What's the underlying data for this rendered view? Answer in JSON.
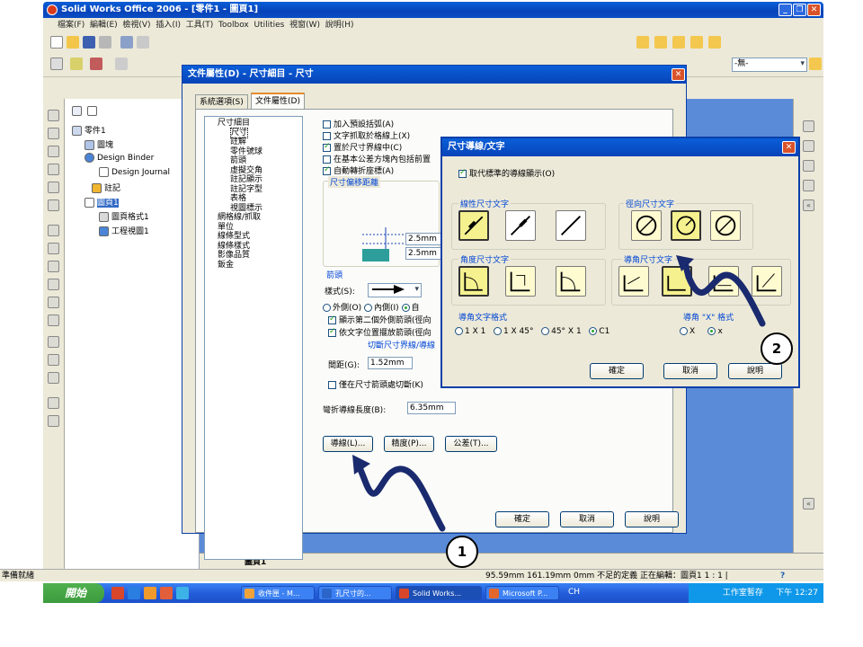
{
  "app": {
    "title": "Solid Works Office 2006 - [零件1 - 圖頁1]",
    "menu": [
      "檔案(F)",
      "編輯(E)",
      "檢視(V)",
      "插入(I)",
      "工具(T)",
      "Toolbox",
      "Utilities",
      "視窗(W)",
      "說明(H)"
    ],
    "style_dropdown": "-無-",
    "status_left": "準備就緒",
    "status_right": "95.59mm   161.19mm   0mm  不足的定義    正在編輯：圖頁1  1 : 1 |",
    "help_glyph": "?",
    "sheet_tab": "圖頁1"
  },
  "tree": {
    "items": [
      {
        "label": "零件1"
      },
      {
        "label": "圖塊"
      },
      {
        "label": "Design Binder"
      },
      {
        "label": "Design Journal"
      },
      {
        "label": "註記"
      },
      {
        "label": "圖頁1"
      },
      {
        "label": "圖頁格式1"
      },
      {
        "label": "工程視圖1"
      }
    ]
  },
  "doc_dialog": {
    "title": "文件屬性(D) - 尺寸細目 - 尺寸",
    "tabs": [
      "系統選項(S)",
      "文件屬性(D)"
    ],
    "tree": [
      "尺寸細目",
      "尺寸",
      "註解",
      "零件號球",
      "箭頭",
      "虛擬交角",
      "註記顯示",
      "註記字型",
      "表格",
      "視圖標示",
      "網格線/抓取",
      "單位",
      "線條型式",
      "線條樣式",
      "影像品質",
      "鈑金"
    ],
    "checks": [
      {
        "label": "加入預設括弧(A)",
        "on": false
      },
      {
        "label": "文字抓取於格線上(X)",
        "on": false
      },
      {
        "label": "置於尺寸界線中(C)",
        "on": true
      },
      {
        "label": "在基本公差方塊內包括前置",
        "on": false
      },
      {
        "label": "自動轉折座標(A)",
        "on": true
      }
    ],
    "offset_group": "尺寸偏移距離",
    "offset1": "2.5mm",
    "offset2": "2.5mm",
    "arrow_group": "箭頭",
    "style_label": "樣式(S):",
    "radios": [
      "外側(O)",
      "內側(I)",
      "自"
    ],
    "check_second": "顯示第二個外側箭頭(徑向",
    "check_textpos": "依文字位置擺放箭頭(徑向",
    "break_group": "切斷尺寸界線/導線",
    "gap_label": "間距(G):",
    "gap_value": "1.52mm",
    "break_only": "僅在尺寸箭頭處切斷(K)",
    "bent_label": "彎折導線長度(B):",
    "bent_value": "6.35mm",
    "btn_leader": "導線(L)...",
    "btn_precision": "精度(P)...",
    "btn_tolerance": "公差(T)...",
    "ok": "確定",
    "cancel": "取消",
    "help": "說明"
  },
  "leader_dialog": {
    "title": "尺寸導線/文字",
    "override": "取代標準的導線顯示(O)",
    "linear": "線性尺寸文字",
    "radial": "徑向尺寸文字",
    "angular": "角度尺寸文字",
    "chamfer": "導角尺寸文字",
    "chamfer_text": "導角文字格式",
    "chamfer_formats": [
      "1 X 1",
      "1 X 45°",
      "45° X 1",
      "C1"
    ],
    "chamfer_x": "導角 \"X\" 格式",
    "x_options": [
      "X",
      "x"
    ],
    "ok": "確定",
    "cancel": "取消",
    "help": "說明"
  },
  "callouts": {
    "one": "1",
    "two": "2"
  },
  "taskbar": {
    "start": "開始",
    "tasks": [
      "收件匣 - M...",
      "孔尺寸的...",
      "Solid Works...",
      "Microsoft P..."
    ],
    "lang": "CH",
    "tray_text": "工作室暫存",
    "clock": "下午 12:27"
  }
}
